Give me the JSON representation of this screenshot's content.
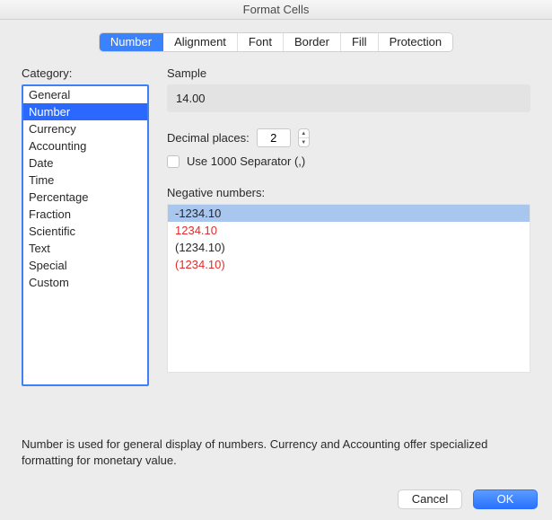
{
  "window": {
    "title": "Format Cells"
  },
  "tabs": [
    "Number",
    "Alignment",
    "Font",
    "Border",
    "Fill",
    "Protection"
  ],
  "active_tab_index": 0,
  "left": {
    "label": "Category:",
    "items": [
      "General",
      "Number",
      "Currency",
      "Accounting",
      "Date",
      "Time",
      "Percentage",
      "Fraction",
      "Scientific",
      "Text",
      "Special",
      "Custom"
    ],
    "selected_index": 1
  },
  "sample": {
    "label": "Sample",
    "value": "14.00"
  },
  "decimal": {
    "label": "Decimal places:",
    "value": "2"
  },
  "separator": {
    "label": "Use 1000 Separator (,)",
    "checked": false
  },
  "negative": {
    "label": "Negative numbers:",
    "items": [
      {
        "text": "-1234.10",
        "red": false
      },
      {
        "text": "1234.10",
        "red": true
      },
      {
        "text": "(1234.10)",
        "red": false
      },
      {
        "text": "(1234.10)",
        "red": true
      }
    ],
    "selected_index": 0
  },
  "description": "Number is used for general display of numbers.  Currency and Accounting offer specialized formatting for monetary value.",
  "buttons": {
    "cancel": "Cancel",
    "ok": "OK"
  }
}
